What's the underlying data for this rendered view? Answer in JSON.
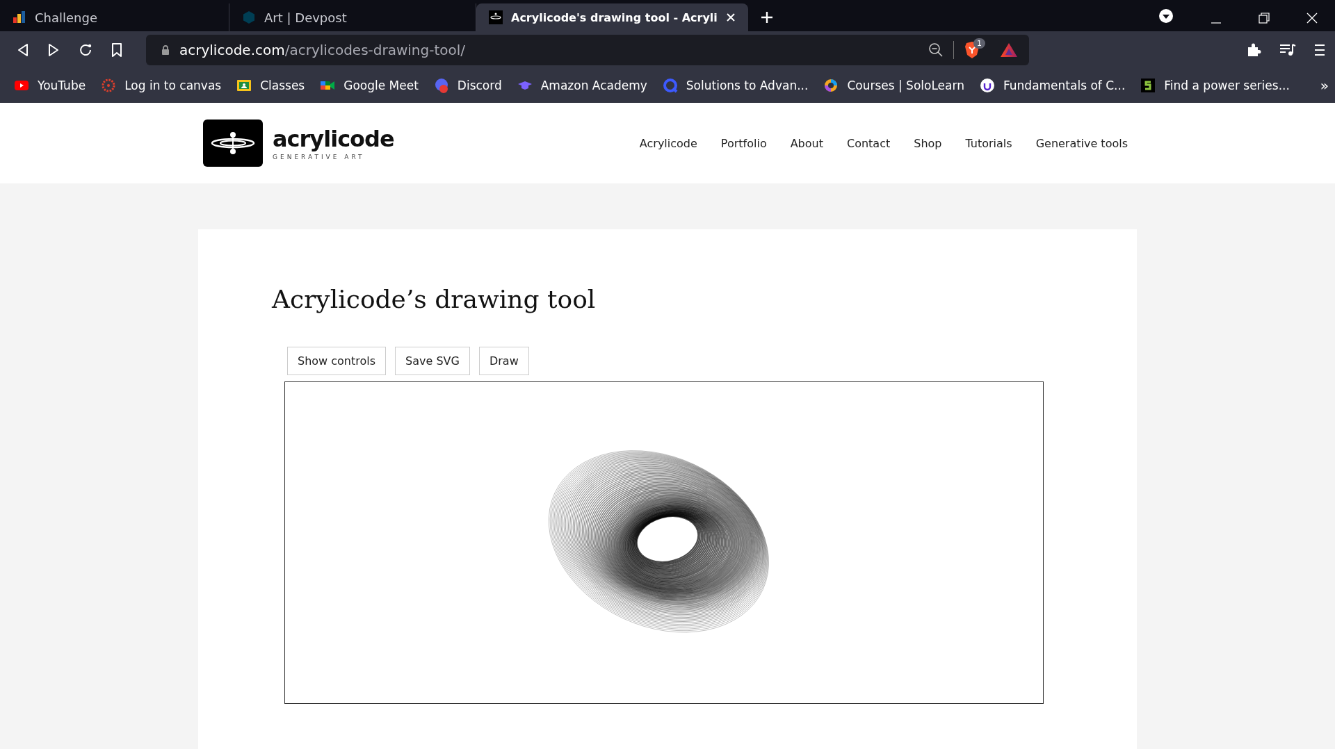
{
  "browser": {
    "tabs": [
      {
        "title": "Challenge",
        "selected": false
      },
      {
        "title": "Art | Devpost",
        "selected": false
      },
      {
        "title": "Acrylicode's drawing tool - Acryli",
        "selected": true
      }
    ],
    "url": {
      "domain": "acrylicode.com",
      "path": "/acrylicodes-drawing-tool/"
    },
    "shields_count": "1",
    "bookmarks": [
      "YouTube",
      "Log in to canvas",
      "Classes",
      "Google Meet",
      "Discord",
      "Amazon Academy",
      "Solutions to Advan...",
      "Courses | SoloLearn",
      "Fundamentals of C...",
      "Find a power series..."
    ],
    "more": "»"
  },
  "site": {
    "logo": {
      "name": "acrylicode",
      "tagline": "GENERATIVE ART"
    },
    "nav": [
      "Acrylicode",
      "Portfolio",
      "About",
      "Contact",
      "Shop",
      "Tutorials",
      "Generative tools"
    ]
  },
  "page": {
    "title": "Acrylicode’s drawing tool",
    "buttons": [
      "Show controls",
      "Save SVG",
      "Draw"
    ]
  }
}
